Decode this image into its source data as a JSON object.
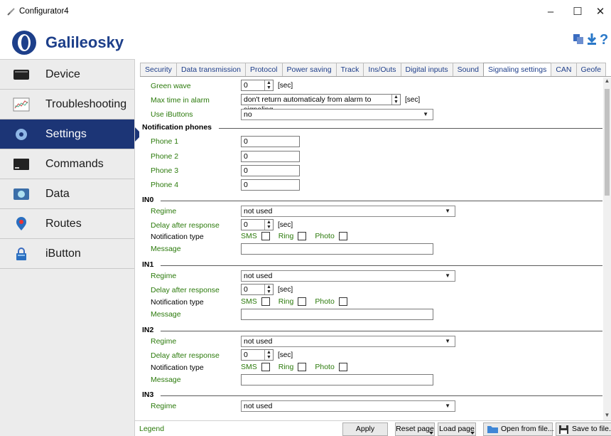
{
  "window": {
    "title": "Configurator4"
  },
  "brand": {
    "name": "Galileosky"
  },
  "sidebar": {
    "items": [
      {
        "label": "Device"
      },
      {
        "label": "Troubleshooting"
      },
      {
        "label": "Settings"
      },
      {
        "label": "Commands"
      },
      {
        "label": "Data"
      },
      {
        "label": "Routes"
      },
      {
        "label": "iButton"
      }
    ]
  },
  "tabs": [
    "Security",
    "Data transmission",
    "Protocol",
    "Power saving",
    "Track",
    "Ins/Outs",
    "Digital inputs",
    "Sound",
    "Signaling settings",
    "CAN",
    "Geofe"
  ],
  "form": {
    "green_wave": {
      "label": "Green wave",
      "value": "0",
      "unit": "[sec]"
    },
    "max_time": {
      "label": "Max time in alarm",
      "value": "don't return automaticaly from alarm to signaling",
      "unit": "[sec]"
    },
    "use_ibuttons": {
      "label": "Use iButtons",
      "value": "no"
    },
    "notification_phones": {
      "title": "Notification phones",
      "phones": [
        {
          "label": "Phone 1",
          "value": "0"
        },
        {
          "label": "Phone 2",
          "value": "0"
        },
        {
          "label": "Phone 3",
          "value": "0"
        },
        {
          "label": "Phone 4",
          "value": "0"
        }
      ]
    },
    "inputs": [
      {
        "title": "IN0",
        "regime_label": "Regime",
        "regime": "not used",
        "delay_label": "Delay after response",
        "delay": "0",
        "delay_unit": "[sec]",
        "notif_label": "Notification type",
        "sms": "SMS",
        "ring": "Ring",
        "photo": "Photo",
        "message_label": "Message",
        "message": ""
      },
      {
        "title": "IN1",
        "regime_label": "Regime",
        "regime": "not used",
        "delay_label": "Delay after response",
        "delay": "0",
        "delay_unit": "[sec]",
        "notif_label": "Notification type",
        "sms": "SMS",
        "ring": "Ring",
        "photo": "Photo",
        "message_label": "Message",
        "message": ""
      },
      {
        "title": "IN2",
        "regime_label": "Regime",
        "regime": "not used",
        "delay_label": "Delay after response",
        "delay": "0",
        "delay_unit": "[sec]",
        "notif_label": "Notification type",
        "sms": "SMS",
        "ring": "Ring",
        "photo": "Photo",
        "message_label": "Message",
        "message": ""
      },
      {
        "title": "IN3",
        "regime_label": "Regime",
        "regime": "not used"
      }
    ]
  },
  "bottom": {
    "legend": "Legend",
    "apply": "Apply",
    "reset": "Reset page",
    "load": "Load page",
    "open": "Open from file...",
    "save": "Save to file..."
  },
  "colors": {
    "accent": "#1c3576",
    "label_green": "#2b7a0b",
    "tab_text": "#1e3e8a"
  }
}
